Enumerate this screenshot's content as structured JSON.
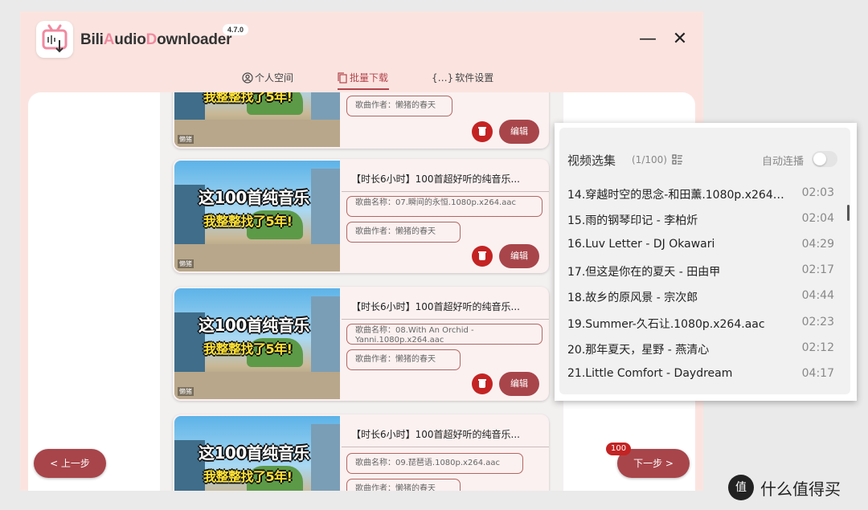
{
  "app": {
    "title_parts": [
      {
        "text": "Bili",
        "accent": false
      },
      {
        "text": "A",
        "accent": true
      },
      {
        "text": "udio",
        "accent": false
      },
      {
        "text": "D",
        "accent": true
      },
      {
        "text": "ownloader",
        "accent": false
      }
    ],
    "version": "4.7.0",
    "minimize_glyph": "—",
    "close_glyph": "✕"
  },
  "tabs": [
    {
      "label": "个人空间",
      "icon": "user-circle-icon",
      "active": false
    },
    {
      "label": "批量下载",
      "icon": "copy-icon",
      "active": true
    },
    {
      "label": "软件设置",
      "icon": "braces-icon",
      "active": false
    }
  ],
  "thumbnail": {
    "line1": "这100首纯音乐",
    "line2": "我整整找了5年!",
    "mark": "懒猪"
  },
  "cards": [
    {
      "title": "",
      "song_name": "",
      "artist": "歌曲作者：懒猪的春天",
      "delete_label": "",
      "edit_label": "编辑"
    },
    {
      "title": "【时长6小时】100首超好听的纯音乐...",
      "song_name": "歌曲名称：07.瞬间的永恒.1080p.x264.aac",
      "artist": "歌曲作者：懒猪的春天",
      "edit_label": "编辑"
    },
    {
      "title": "【时长6小时】100首超好听的纯音乐...",
      "song_name": "歌曲名称：08.With An Orchid - Yanni.1080p.x264.aac",
      "artist": "歌曲作者：懒猪的春天",
      "edit_label": "编辑"
    },
    {
      "title": "【时长6小时】100首超好听的纯音乐...",
      "song_name": "歌曲名称：09.琵琶语.1080p.x264.aac",
      "artist": "歌曲作者：懒猪的春天",
      "edit_label": "编辑"
    }
  ],
  "nav": {
    "prev_label": "< 上一步",
    "next_label": "下一步 >",
    "next_badge": "100"
  },
  "playlist": {
    "title": "视频选集",
    "count": "(1/100)",
    "autoplay_label": "自动连播",
    "autoplay_on": false,
    "items": [
      {
        "name": "14.穿越时空的思念-和田薰.1080p.x264.aac",
        "duration": "02:03"
      },
      {
        "name": "15.雨的钢琴印记 - 李柏炘",
        "duration": "02:04"
      },
      {
        "name": "16.Luv Letter - DJ Okawari",
        "duration": "04:29"
      },
      {
        "name": "17.但这是你在的夏天 - 田由甲",
        "duration": "02:17"
      },
      {
        "name": "18.故乡的原风景 - 宗次郎",
        "duration": "04:44"
      },
      {
        "name": "19.Summer-久石让.1080p.x264.aac",
        "duration": "02:23"
      },
      {
        "name": "20.那年夏天，星野 - 燕清心",
        "duration": "02:12"
      },
      {
        "name": "21.Little Comfort - Daydream",
        "duration": "04:17"
      }
    ]
  },
  "watermark": {
    "badge": "值",
    "text": "什么值得买"
  },
  "colors": {
    "accent": "#a8454a",
    "delete": "#c42323",
    "window_bg": "#fbe4e0",
    "logo_accent": "#f08aa0"
  }
}
